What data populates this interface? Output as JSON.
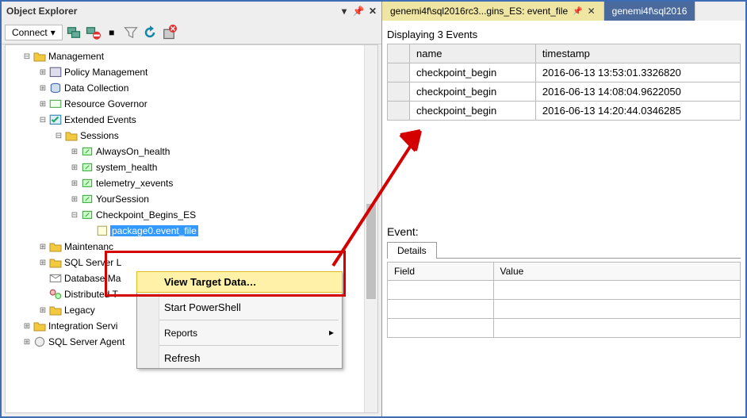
{
  "left_panel": {
    "title": "Object Explorer",
    "connect_label": "Connect",
    "tree": {
      "management": "Management",
      "policy": "Policy Management",
      "data_collection": "Data Collection",
      "resource_gov": "Resource Governor",
      "extended_events": "Extended Events",
      "sessions": "Sessions",
      "alwayson": "AlwaysOn_health",
      "system_health": "system_health",
      "telemetry": "telemetry_xevents",
      "yoursession": "YourSession",
      "checkpoint": "Checkpoint_Begins_ES",
      "package0": "package0.event_file",
      "maintenance": "Maintenanc",
      "sqlserver": "SQL Server L",
      "database_m": "Database Ma",
      "distributed": "Distributed T",
      "legacy": "Legacy",
      "integration": "Integration Servi",
      "sql_agent": "SQL Server Agent"
    }
  },
  "context_menu": {
    "view_target": "View Target Data…",
    "start_ps": "Start PowerShell",
    "reports": "Reports",
    "refresh": "Refresh"
  },
  "right_panel": {
    "tab1": "genemi4f\\sql2016rc3...gins_ES: event_file",
    "tab2": "genemi4f\\sql2016",
    "display_label": "Displaying 3 Events",
    "col_name": "name",
    "col_timestamp": "timestamp",
    "rows": [
      {
        "name": "checkpoint_begin",
        "ts": "2016-06-13 13:53:01.3326820"
      },
      {
        "name": "checkpoint_begin",
        "ts": "2016-06-13 14:08:04.9622050"
      },
      {
        "name": "checkpoint_begin",
        "ts": "2016-06-13 14:20:44.0346285"
      }
    ],
    "event_label": "Event:",
    "details_tab": "Details",
    "field_col": "Field",
    "value_col": "Value"
  }
}
